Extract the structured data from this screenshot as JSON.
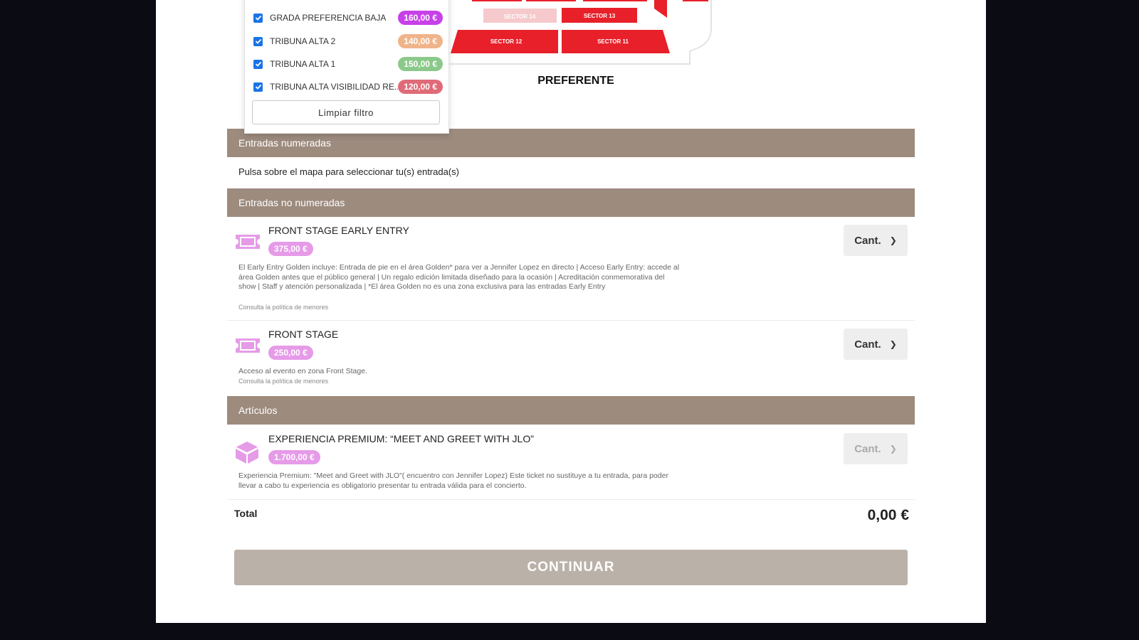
{
  "filter": {
    "items": [
      {
        "label": "GRADA PREFERENCIA BAJA",
        "price": "160,00 €",
        "color": "#c740e8"
      },
      {
        "label": "TRIBUNA ALTA 2",
        "price": "140,00 €",
        "color": "#f0b48a"
      },
      {
        "label": "TRIBUNA ALTA 1",
        "price": "150,00 €",
        "color": "#8bc98a"
      },
      {
        "label": "TRIBUNA ALTA VISIBILIDAD RE...",
        "price": "120,00 €",
        "color": "#e06b78"
      }
    ],
    "clear_label": "Limpiar filtro"
  },
  "map": {
    "zone_label": "PREFERENTE",
    "sectors": [
      "SECTOR 14",
      "SECTOR 13",
      "SECTOR 12",
      "SECTOR 11"
    ],
    "color": "#e8202a"
  },
  "numbered": {
    "header": "Entradas numeradas",
    "hint": "Pulsa sobre el mapa para seleccionar tu(s) entrada(s)"
  },
  "unnumbered": {
    "header": "Entradas no numeradas",
    "items": [
      {
        "title": "FRONT STAGE EARLY ENTRY",
        "price": "375,00 €",
        "description": "El Early Entry Golden incluye: Entrada de pie en el área Golden* para ver a Jennifer Lopez en directo | Acceso Early Entry: accede al área Golden antes que el público general | Un regalo edición limitada diseñado para la ocasión | Acreditación conmemorativa del show | Staff y atención personalizada | *El área Golden no es una zona exclusiva para las entradas Early Entry",
        "policy": "Consulta la política de menores",
        "qty": "Cant."
      },
      {
        "title": "FRONT STAGE",
        "price": "250,00 €",
        "description": "Acceso al evento en zona Front Stage.",
        "policy": "Consulta la política de menores",
        "qty": "Cant."
      }
    ]
  },
  "articles": {
    "header": "Artículos",
    "items": [
      {
        "title": "EXPERIENCIA PREMIUM: “MEET AND GREET WITH JLO”",
        "price": "1.700,00 €",
        "description": "Experiencia Premium: \"Meet and Greet with JLO\"( encuentro con Jennifer Lopez) Este ticket no sustituye a tu entrada, para poder llevar a cabo tu experiencia es obligatorio presentar tu entrada válida para el concierto.",
        "qty": "Cant."
      }
    ]
  },
  "total": {
    "label": "Total",
    "value": "0,00 €"
  },
  "continue_label": "CONTINUAR",
  "accent_color": "#9d8b7e",
  "icon_color": "#e59be8"
}
